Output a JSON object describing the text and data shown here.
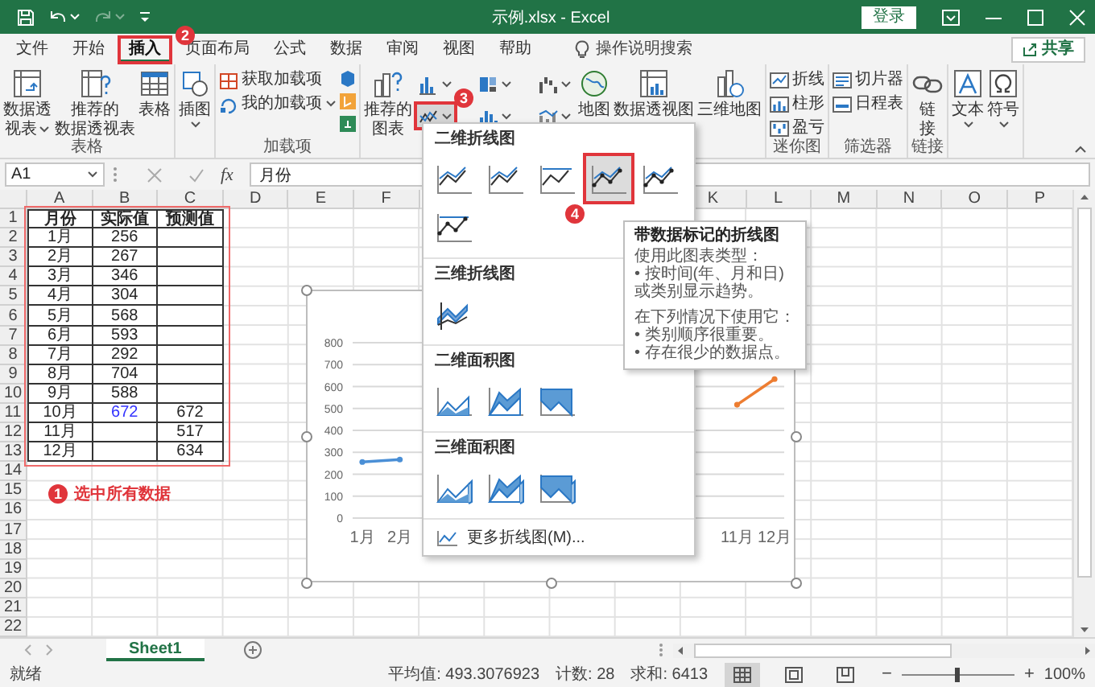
{
  "title_bar": {
    "title": "示例.xlsx - Excel",
    "sign_in": "登录"
  },
  "tabs": [
    {
      "label": "文件",
      "selected": false
    },
    {
      "label": "开始",
      "selected": false
    },
    {
      "label": "插入",
      "selected": true
    },
    {
      "label": "页面布局",
      "selected": false
    },
    {
      "label": "公式",
      "selected": false
    },
    {
      "label": "数据",
      "selected": false
    },
    {
      "label": "审阅",
      "selected": false
    },
    {
      "label": "视图",
      "selected": false
    },
    {
      "label": "帮助",
      "selected": false
    }
  ],
  "tell_me": "操作说明搜索",
  "share": "共享",
  "ribbon": {
    "groups": [
      {
        "label": "表格",
        "items": [
          {
            "kind": "large",
            "lines": [
              "数据透",
              "视表"
            ],
            "dropdown": true
          },
          {
            "kind": "large",
            "lines": [
              "推荐的",
              "数据透视表"
            ],
            "dropdown": false
          },
          {
            "kind": "large",
            "lines": [
              "表格"
            ],
            "dropdown": false
          }
        ]
      },
      {
        "items": [
          {
            "kind": "large",
            "lines": [
              "插图"
            ],
            "dropdown": true
          }
        ]
      },
      {
        "label": "加载项",
        "items": [
          {
            "kind": "small",
            "label": "获取加载项",
            "dropdown": false
          },
          {
            "kind": "small",
            "label": "我的加载项",
            "dropdown": true
          },
          {
            "kind": "icon-stack"
          }
        ]
      },
      {
        "items": [
          {
            "kind": "large",
            "lines": [
              "推荐的",
              "图表"
            ],
            "dropdown": false
          },
          {
            "kind": "chart-buttons",
            "buttons": [
              {
                "selected": false
              },
              {
                "selected": false
              },
              {
                "selected": false
              },
              {
                "selected": true
              },
              {
                "selected": false
              },
              {
                "selected": false
              }
            ]
          },
          {
            "kind": "large",
            "lines": [
              "地图"
            ],
            "dropdown": false
          },
          {
            "kind": "large",
            "lines": [
              "数据透视图"
            ],
            "dropdown": false
          },
          {
            "kind": "large",
            "lines": [
              "三维地图"
            ],
            "dropdown": false
          }
        ]
      },
      {
        "label": "迷你图",
        "items": [
          {
            "kind": "small",
            "label": "折线",
            "dropdown": false
          },
          {
            "kind": "small",
            "label": "柱形",
            "dropdown": false
          },
          {
            "kind": "small",
            "label": "盈亏",
            "dropdown": false
          }
        ]
      },
      {
        "label": "筛选器",
        "items": [
          {
            "kind": "small",
            "label": "切片器",
            "dropdown": false
          },
          {
            "kind": "small",
            "label": "日程表",
            "dropdown": false
          }
        ]
      },
      {
        "label": "链接",
        "items": [
          {
            "kind": "large",
            "lines": [
              "链",
              "接"
            ],
            "dropdown": false
          }
        ]
      },
      {
        "items": [
          {
            "kind": "large",
            "lines": [
              "文本"
            ],
            "dropdown": true
          },
          {
            "kind": "large",
            "lines": [
              "符号"
            ],
            "dropdown": true
          }
        ]
      }
    ]
  },
  "formula_bar": {
    "name_box": "A1",
    "function_label": "fx",
    "content": "月份"
  },
  "sheet": {
    "columns_left": [
      "A",
      "B",
      "C",
      "D",
      "E",
      "F"
    ],
    "columns_right": [
      "K",
      "L",
      "M",
      "N",
      "O",
      "P"
    ],
    "row_numbers": [
      "1",
      "2",
      "3",
      "4",
      "5",
      "6",
      "7",
      "8",
      "9",
      "10",
      "11",
      "12",
      "13",
      "14",
      "15",
      "16",
      "17",
      "18",
      "19",
      "20",
      "21",
      "22"
    ],
    "header": [
      "月份",
      "实际值",
      "预测值"
    ],
    "rows": [
      {
        "month": "1月",
        "actual": "256"
      },
      {
        "month": "2月",
        "actual": "267"
      },
      {
        "month": "3月",
        "actual": "346"
      },
      {
        "month": "4月",
        "actual": "304"
      },
      {
        "month": "5月",
        "actual": "568"
      },
      {
        "month": "6月",
        "actual": "593"
      },
      {
        "month": "7月",
        "actual": "292"
      },
      {
        "month": "8月",
        "actual": "704"
      },
      {
        "month": "9月",
        "actual": "588"
      },
      {
        "month": "10月",
        "actual": "672",
        "color": "#3333ff",
        "forecast": "672"
      },
      {
        "month": "11月",
        "forecast": "517"
      },
      {
        "month": "12月",
        "forecast": "634"
      }
    ]
  },
  "chart": {
    "chart_data": {
      "type": "line",
      "categories": [
        "1月",
        "2月",
        null,
        null,
        null,
        null,
        null,
        null,
        null,
        null,
        "11月",
        "12月"
      ],
      "series": [
        {
          "color": "#4a8fd6",
          "marker": true,
          "values": [
            256,
            267,
            null,
            null,
            null,
            null,
            null,
            null,
            null,
            null,
            null,
            null
          ]
        },
        {
          "color": "#ed7d31",
          "marker": true,
          "values": [
            null,
            null,
            null,
            null,
            null,
            null,
            null,
            null,
            null,
            null,
            517,
            634
          ]
        }
      ],
      "ylim": [
        0,
        800
      ],
      "yticks": [
        0,
        100,
        200,
        300,
        400,
        500,
        600,
        700,
        800
      ],
      "grid": true
    }
  },
  "line_menu": {
    "sections": [
      {
        "heading": "二维折线图",
        "options": [
          {
            "selected": false
          },
          {
            "selected": false
          },
          {
            "selected": false
          },
          {
            "selected": true
          },
          {
            "selected": false
          },
          {
            "selected": false
          }
        ]
      },
      {
        "heading": "三维折线图",
        "options": [
          {
            "selected": false
          }
        ]
      },
      {
        "heading": "二维面积图",
        "options": [
          {
            "selected": false
          },
          {
            "selected": false
          },
          {
            "selected": false
          }
        ]
      },
      {
        "heading": "三维面积图",
        "options": [
          {
            "selected": false
          },
          {
            "selected": false
          },
          {
            "selected": false
          }
        ]
      }
    ],
    "more": "更多折线图(M)..."
  },
  "tooltip": {
    "title": "带数据标记的折线图",
    "paragraphs": [
      [
        "使用此图表类型：",
        "• 按时间(年、月和日)",
        "或类别显示趋势。"
      ],
      [
        "在下列情况下使用它：",
        "• 类别顺序很重要。",
        "• 存在很少的数据点。"
      ]
    ]
  },
  "annotations": [
    {
      "number": "1",
      "text": "选中所有数据"
    },
    {
      "number": "2"
    },
    {
      "number": "3"
    },
    {
      "number": "4"
    }
  ],
  "sheet_tabs": [
    {
      "label": "Sheet1",
      "selected": true
    }
  ],
  "status_bar": {
    "ready": "就绪",
    "stats": [
      "平均值: 493.3076923",
      "计数: 28",
      "求和: 6413"
    ],
    "views": [
      {
        "selected": true
      },
      {
        "selected": false
      },
      {
        "selected": false
      }
    ],
    "zoom": {
      "minus": "−",
      "plus": "+",
      "level": 0.5,
      "percent": "100%"
    }
  }
}
